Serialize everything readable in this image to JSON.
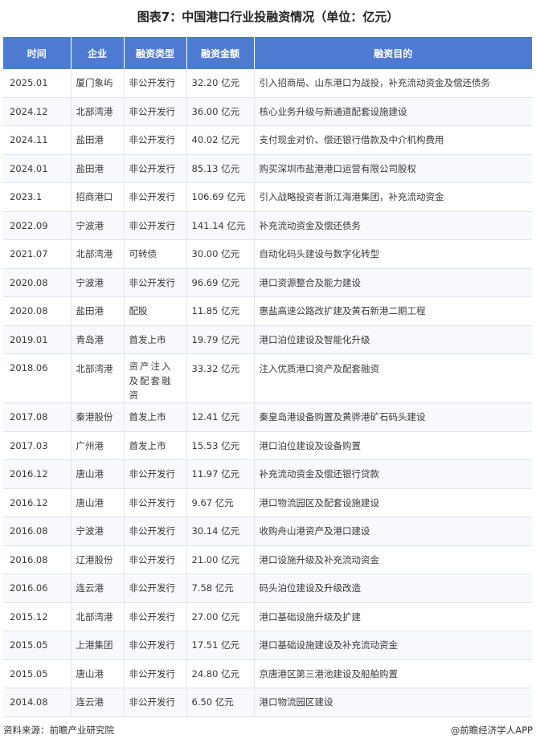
{
  "title": "图表7：中国港口行业投融资情况（单位：亿元）",
  "table": {
    "headers": [
      "时间",
      "企业",
      "融资类型",
      "融资金额",
      "融资目的"
    ],
    "rows": [
      [
        "2025.01",
        "厦门象屿",
        "非公开发行",
        "32.20 亿元",
        "引入招商局、山东港口为战投，补充流动资金及偿还债务"
      ],
      [
        "2024.12",
        "北部湾港",
        "非公开发行",
        "36.00 亿元",
        "核心业务升级与新通道配套设施建设"
      ],
      [
        "2024.11",
        "盐田港",
        "非公开发行",
        "40.02 亿元",
        "支付现金对价、偿还银行借款及中介机构费用"
      ],
      [
        "2024.01",
        "盐田港",
        "非公开发行",
        "85.13 亿元",
        "购买深圳市盐港港口运营有限公司股权"
      ],
      [
        "2023.1",
        "招商港口",
        "非公开发行",
        "106.69 亿元",
        "引入战略投资者浙江海港集团，补充流动资金"
      ],
      [
        "2022.09",
        "宁波港",
        "非公开发行",
        "141.14 亿元",
        "补充流动资金及偿还债务"
      ],
      [
        "2021.07",
        "北部湾港",
        "可转债",
        "30.00 亿元",
        "自动化码头建设与数字化转型"
      ],
      [
        "2020.08",
        "宁波港",
        "非公开发行",
        "96.69 亿元",
        "港口资源整合及能力建设"
      ],
      [
        "2020.08",
        "盐田港",
        "配股",
        "11.85 亿元",
        "惠盐高速公路改扩建及黄石新港二期工程"
      ],
      [
        "2019.01",
        "青岛港",
        "首发上市",
        "19.79 亿元",
        "港口泊位建设及智能化升级"
      ],
      [
        "2018.06",
        "北部湾港",
        "资产注入及配套融资",
        "33.32 亿元",
        "注入优质港口资产及配套融资"
      ],
      [
        "2017.08",
        "秦港股份",
        "首发上市",
        "12.41 亿元",
        "秦皇岛港设备购置及黄骅港矿石码头建设"
      ],
      [
        "2017.03",
        "广州港",
        "首发上市",
        "15.53 亿元",
        "港口泊位建设及设备购置"
      ],
      [
        "2016.12",
        "唐山港",
        "非公开发行",
        "11.97 亿元",
        "补充流动资金及偿还银行贷款"
      ],
      [
        "2016.12",
        "唐山港",
        "非公开发行",
        "9.67 亿元",
        "港口物流园区及配套设施建设"
      ],
      [
        "2016.08",
        "宁波港",
        "非公开发行",
        "30.14 亿元",
        "收购舟山港资产及港口建设"
      ],
      [
        "2016.08",
        "辽港股份",
        "非公开发行",
        "21.00 亿元",
        "港口设施升级及补充流动资金"
      ],
      [
        "2016.06",
        "连云港",
        "非公开发行",
        "7.58 亿元",
        "码头泊位建设及升级改造"
      ],
      [
        "2015.12",
        "北部湾港",
        "非公开发行",
        "27.00 亿元",
        "港口基础设施升级及扩建"
      ],
      [
        "2015.05",
        "上港集团",
        "非公开发行",
        "17.51 亿元",
        "港口基础设施建设及补充流动资金"
      ],
      [
        "2015.05",
        "唐山港",
        "非公开发行",
        "24.80 亿元",
        "京唐港区第三港池建设及船舶购置"
      ],
      [
        "2014.08",
        "连云港",
        "非公开发行",
        "6.50 亿元",
        "港口物流园区建设"
      ]
    ]
  },
  "footer": {
    "source": "资料来源：前瞻产业研究院",
    "credit": "@前瞻经济学人APP"
  }
}
